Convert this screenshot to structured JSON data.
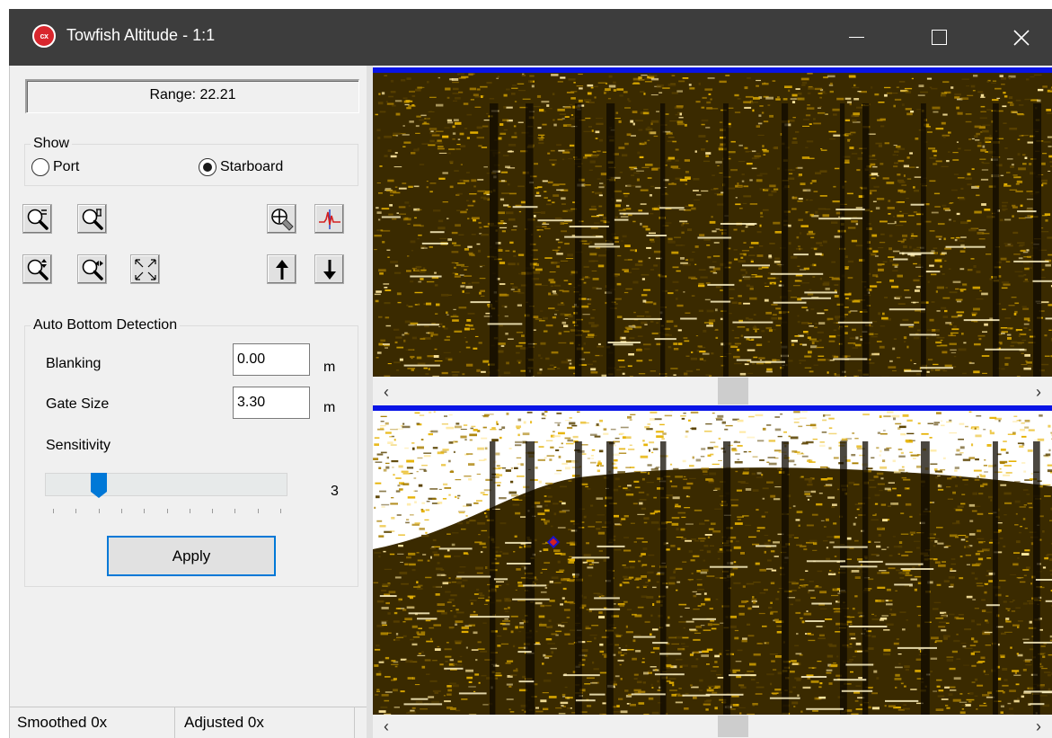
{
  "window": {
    "title": "Towfish Altitude - 1:1",
    "app_icon_label": "cx",
    "controls": {
      "minimize": "minimize-icon",
      "maximize": "maximize-icon",
      "close": "close-icon"
    }
  },
  "range": {
    "text": "Range: 22.21"
  },
  "show": {
    "legend": "Show",
    "options": [
      {
        "label": "Port",
        "selected": false
      },
      {
        "label": "Starboard",
        "selected": true
      }
    ]
  },
  "toolbar": {
    "icons": [
      "zoom-in-vertical-icon",
      "zoom-out-vertical-icon",
      "zoom-in-horizontal-icon",
      "zoom-out-horizontal-icon",
      "fit-to-window-icon",
      "crosshair-tool-icon",
      "waveform-icon",
      "arrow-up-icon",
      "arrow-down-icon"
    ]
  },
  "auto_bottom": {
    "legend": "Auto Bottom Detection",
    "blanking": {
      "label": "Blanking",
      "value": "0.00",
      "unit": "m"
    },
    "gate_size": {
      "label": "Gate Size",
      "value": "3.30",
      "unit": "m"
    },
    "sensitivity": {
      "label": "Sensitivity",
      "value": "3",
      "min": 1,
      "max": 11
    },
    "apply_label": "Apply"
  },
  "status": {
    "smoothed": "Smoothed 0x",
    "adjusted": "Adjusted 0x"
  },
  "colors": {
    "title_bar": "#3d3d3d",
    "sonar_gold": "#e6b100",
    "sonar_line": "#0a14e6",
    "accent": "#0078d7"
  }
}
